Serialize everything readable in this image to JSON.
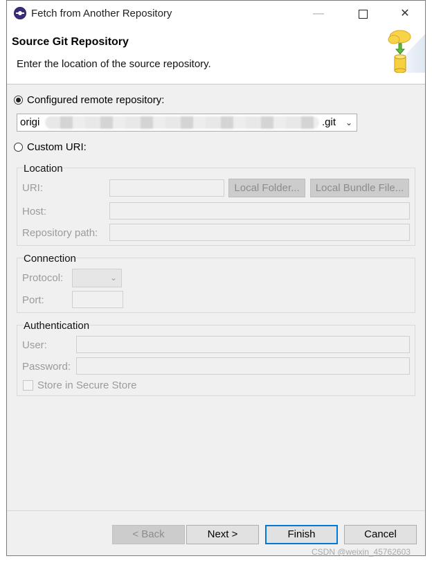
{
  "window": {
    "title": "Fetch from Another Repository",
    "minimize_glyph": "—",
    "close_glyph": "✕"
  },
  "header": {
    "title": "Source Git Repository",
    "description": "Enter the location of the source repository."
  },
  "source": {
    "configured_label": "Configured remote repository:",
    "configured_selected": true,
    "remote_value_start": "origi",
    "remote_value_end": ".git",
    "custom_label": "Custom URI:",
    "custom_selected": false
  },
  "location": {
    "group_title": "Location",
    "uri_label": "URI:",
    "local_folder_button": "Local Folder...",
    "local_bundle_button": "Local Bundle File...",
    "host_label": "Host:",
    "repo_path_label": "Repository path:"
  },
  "connection": {
    "group_title": "Connection",
    "protocol_label": "Protocol:",
    "port_label": "Port:"
  },
  "authentication": {
    "group_title": "Authentication",
    "user_label": "User:",
    "password_label": "Password:",
    "store_label": "Store in Secure Store",
    "store_checked": false
  },
  "buttons": {
    "back": "< Back",
    "next": "Next >",
    "finish": "Finish",
    "cancel": "Cancel"
  },
  "watermark": "CSDN @weixin_45762603",
  "icons": [
    "eclipse-logo-icon",
    "cloud-download-database-icon",
    "chevron-down-icon",
    "minimize-icon",
    "maximize-icon",
    "close-icon"
  ]
}
